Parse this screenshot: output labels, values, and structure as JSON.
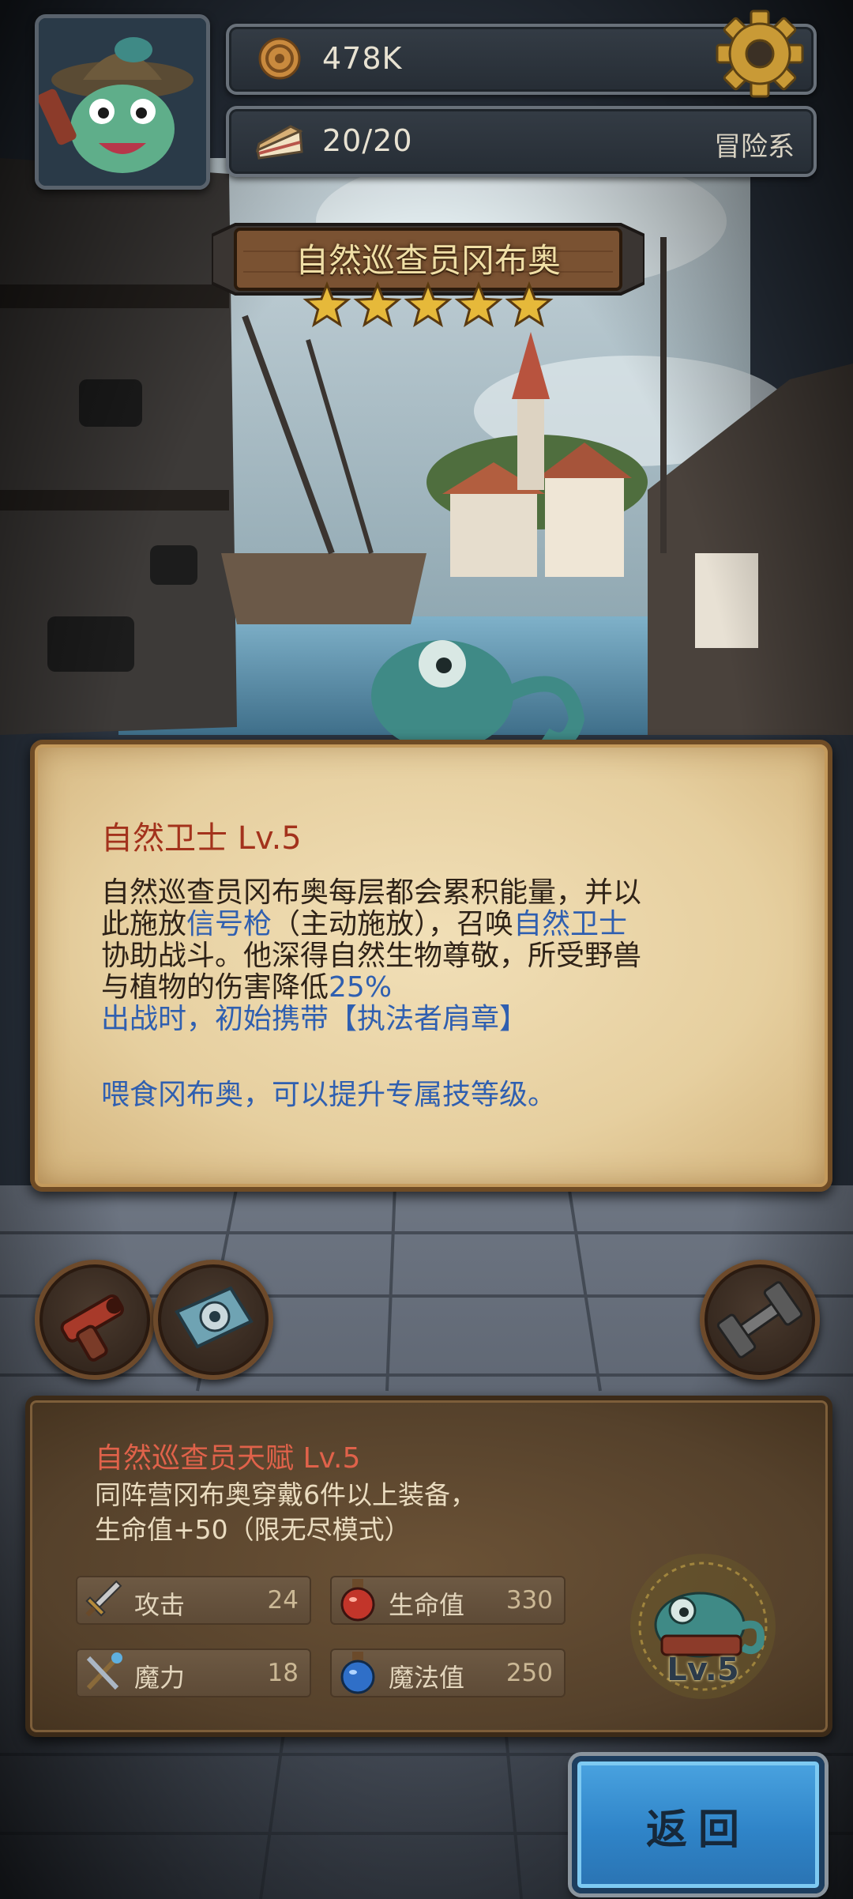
{
  "hud": {
    "coins": "478K",
    "energy": "20/20",
    "category": "冒险系",
    "settings_icon": "gear-icon",
    "coin_icon": "coin-icon",
    "energy_icon": "cake-slice-icon"
  },
  "hero": {
    "name": "自然巡查员冈布奥",
    "stars": 5
  },
  "skill": {
    "title": "自然卫士 Lv.5",
    "line1": "自然巡查员冈布奥每层都会累积能量，并以",
    "line2_a": "此施放",
    "line2_hl1": "信号枪",
    "line2_b": "（主动施放），召唤",
    "line2_hl2": "自然卫士",
    "line3": "协助战斗。他深得自然生物尊敬，所受野兽",
    "line4_a": "与植物的伤害降低",
    "line4_hl": "25%",
    "line5": "出战时，初始携带【执法者肩章】",
    "note": "喂食冈布奥，可以提升专属技等级。"
  },
  "items": {
    "left1": "flare-gun-icon",
    "left2": "badge-icon",
    "right1": "dumbbell-icon"
  },
  "talent": {
    "title": "自然巡查员天赋 Lv.5",
    "desc1": "同阵营冈布奥穿戴6件以上装备，",
    "desc2": "生命值+50（限无尽模式）",
    "level_badge": "Lv.5",
    "stats": [
      {
        "label": "攻击",
        "value": "24",
        "icon": "sword-icon"
      },
      {
        "label": "生命值",
        "value": "330",
        "icon": "red-potion-icon"
      },
      {
        "label": "魔力",
        "value": "18",
        "icon": "staff-icon"
      },
      {
        "label": "魔法值",
        "value": "250",
        "icon": "blue-potion-icon"
      }
    ]
  },
  "back_button": {
    "label": "返回"
  }
}
